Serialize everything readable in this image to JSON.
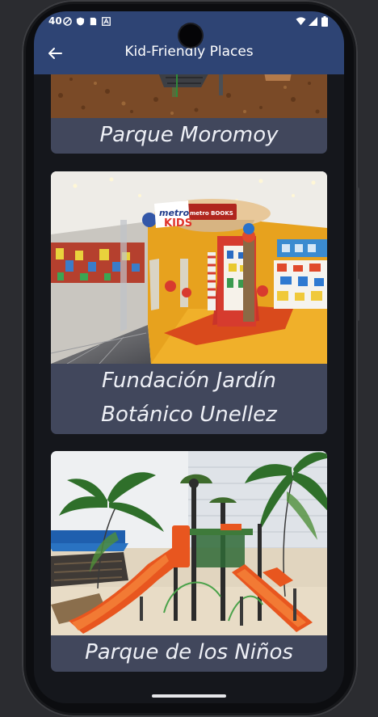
{
  "status_bar": {
    "time": "40"
  },
  "app_bar": {
    "title": "Kid-Friendly Places",
    "back_icon": "arrow-left-icon"
  },
  "places": [
    {
      "name": "Parque Moromoy"
    },
    {
      "name": "Fundación Jardín Botánico Unellez"
    },
    {
      "name": "Parque de los Niños"
    }
  ],
  "store_sign": {
    "brand": "metro",
    "kids": "KIDS",
    "books": "metro BOOKS"
  },
  "colors": {
    "app_bar": "#2e4474",
    "card": "#41475c",
    "background": "#15171c"
  }
}
